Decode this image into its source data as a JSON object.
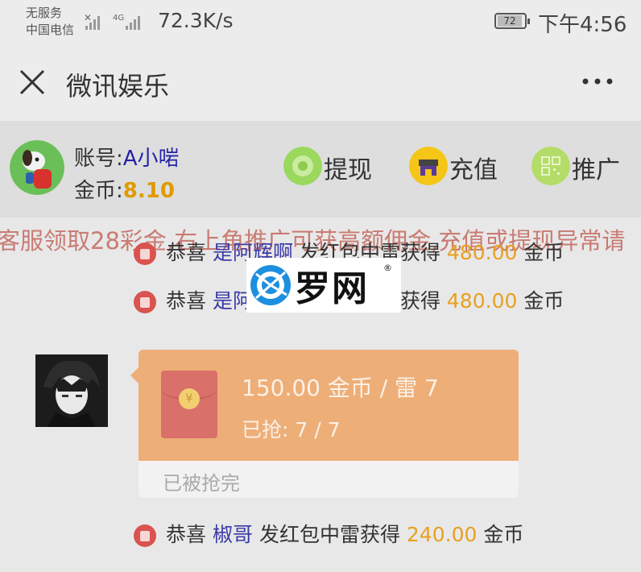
{
  "status_bar": {
    "carrier_line1": "无服务",
    "carrier_line2": "中国电信",
    "network": "4G",
    "speed": "72.3K/s",
    "battery": "72",
    "time": "下午4:56"
  },
  "title_bar": {
    "title": "微讯娱乐"
  },
  "account": {
    "account_label": "账号:",
    "account_value": "A小啱",
    "coins_label": "金币:",
    "coins_value": "8.10",
    "actions": [
      {
        "label": "提现",
        "icon": "withdraw-icon",
        "color": "#8fd44f"
      },
      {
        "label": "充值",
        "icon": "shop-icon",
        "color": "#f5c518"
      },
      {
        "label": "推广",
        "icon": "qr-code-icon",
        "color": "#a8d45a"
      }
    ]
  },
  "notice": "客服领取28彩金,右上角推广可获高额佣金,充值或提现异常请",
  "messages": [
    {
      "prefix": "恭喜",
      "who": "是阿辉啊",
      "action": "发红包中雷获得",
      "amount": "480.00",
      "unit": "金币"
    },
    {
      "prefix": "恭喜",
      "who": "是阿辉啊",
      "action": "发红包中雷获得",
      "amount": "480.00",
      "unit": "金币"
    },
    {
      "prefix": "恭喜",
      "who": "椒哥",
      "action": "发红包中雷获得",
      "amount": "240.00",
      "unit": "金币"
    }
  ],
  "watermark": {
    "text": "罗网",
    "reg": "®"
  },
  "red_packet": {
    "title": "150.00 金币 / 雷 7",
    "grabbed": "已抢: 7 / 7",
    "status": "已被抢完",
    "coin_symbol": "¥"
  }
}
